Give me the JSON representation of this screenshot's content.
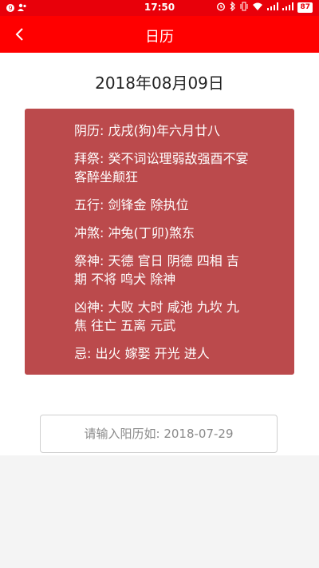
{
  "status_bar": {
    "time": "17:50",
    "battery": "87"
  },
  "header": {
    "title": "日历",
    "back_icon": "chevron-left-icon"
  },
  "main": {
    "date": "2018年08月09日",
    "info": [
      "阴历: 戊戌(狗)年六月廿八",
      "拜祭: 癸不词讼理弱敌强酉不宴客醉坐颠狂",
      "五行: 剑锋金 除执位",
      "冲煞: 冲兔(丁卯)煞东",
      "祭神: 天德 官日 阴德 四相 吉期 不将 鸣犬 除神",
      "凶神: 大败 大时 咸池 九坎 九焦 往亡 五离 元武",
      "忌: 出火 嫁娶 开光 进人"
    ],
    "input_placeholder": "请输入阳历如: 2018-07-29"
  },
  "colors": {
    "status_bar": "#e8000a",
    "title_bar": "#ff0000",
    "card": "#bb4a4c"
  }
}
